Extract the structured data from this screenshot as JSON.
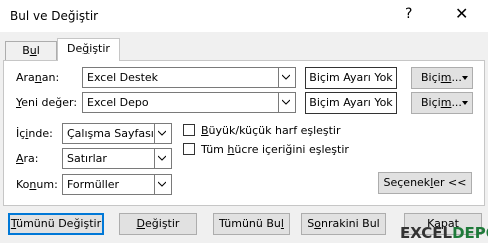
{
  "window": {
    "title": "Bul ve Değiştir",
    "help_glyph": "?",
    "close_glyph": "✕"
  },
  "tabs": [
    {
      "label": "Bul",
      "ul": "u",
      "rest": "l",
      "pre": "B"
    },
    {
      "label": "Değiştir",
      "pre": "De",
      "ul": "ğ",
      "rest": "iştir"
    }
  ],
  "fields": {
    "find": {
      "label_pre": "Ara",
      "label_ul": "n",
      "label_rest": "an:",
      "value": "Excel Destek",
      "format": "Biçim Ayarı Yok"
    },
    "replace": {
      "label_pre": "",
      "label_ul": "Y",
      "label_rest": "eni değer:",
      "value": "Excel Depo",
      "format": "Biçim Ayarı Yok"
    },
    "format_button": {
      "pre": "Biçi",
      "ul": "m",
      "rest": "..."
    }
  },
  "options": {
    "within": {
      "label_pre": "İç",
      "label_ul": "i",
      "label_rest": "nde:",
      "value": "Çalışma Sayfası"
    },
    "search": {
      "label_pre": "",
      "label_ul": "A",
      "label_rest": "ra:",
      "value": "Satırlar"
    },
    "lookin": {
      "label_pre": "Ko",
      "label_ul": "n",
      "label_rest": "um:",
      "value": "Formüller"
    },
    "match_case": {
      "pre": "",
      "ul": "B",
      "rest": "üyük/küçük harf eşleştir",
      "checked": false
    },
    "match_entire": {
      "pre": "Tüm ",
      "ul": "h",
      "rest": "ücre içeriğini eşleştir",
      "checked": false
    },
    "options_button": {
      "pre": "Seçenek",
      "ul": "l",
      "rest": "er <<"
    }
  },
  "buttons": {
    "replace_all": {
      "pre": "",
      "ul": "T",
      "rest": "ümünü Değiştir"
    },
    "replace": {
      "pre": "",
      "ul": "D",
      "rest": "eğiştir"
    },
    "find_all": {
      "pre": "Tümünü Bu",
      "ul": "l",
      "rest": ""
    },
    "find_next": {
      "pre": "S",
      "ul": "o",
      "rest": "nrakini Bul"
    },
    "close": {
      "label": "Kapat"
    }
  },
  "watermark": {
    "a": "EXCEL",
    "b": "DEPO"
  },
  "colors": {
    "accent": "#0078d7",
    "brand": "#1f7a3a"
  }
}
